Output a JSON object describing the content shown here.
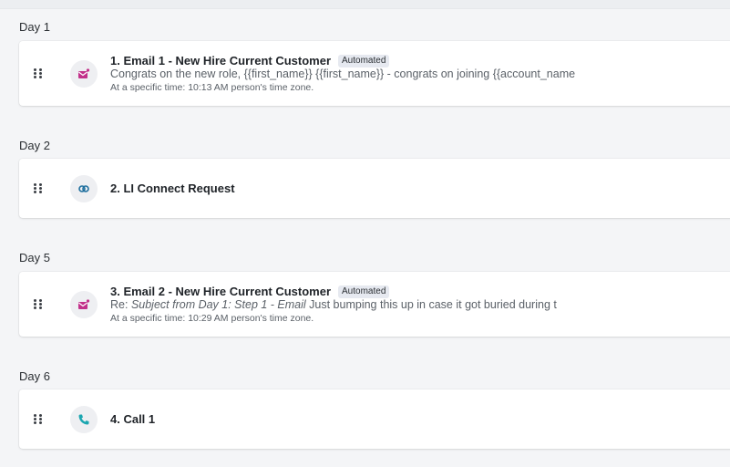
{
  "colors": {
    "background": "#f4f5f7",
    "card": "#ffffff",
    "email_icon": "#c2308a",
    "linkedin_icon": "#1f6f9e",
    "call_icon": "#1ba6b0"
  },
  "steps": [
    {
      "day_label": "Day 1",
      "icon": "email-icon",
      "title": "1. Email 1 - New Hire Current Customer",
      "badge": "Automated",
      "preview": "Congrats on the new role, {{first_name}} {{first_name}} - congrats on joining {{account_name",
      "timing": "At a specific time: 10:13 AM person's time zone."
    },
    {
      "day_label": "Day 2",
      "icon": "linkedin-connect-icon",
      "title": "2. LI Connect Request"
    },
    {
      "day_label": "Day 5",
      "icon": "email-icon",
      "title": "3. Email 2 - New Hire Current Customer",
      "badge": "Automated",
      "preview_prefix": "Re: ",
      "preview_italic": "Subject from Day 1: Step 1 - Email",
      "preview_rest": " Just bumping this up in case it got buried during t",
      "timing": "At a specific time: 10:29 AM person's time zone."
    },
    {
      "day_label": "Day 6",
      "icon": "phone-icon",
      "title": "4. Call 1"
    }
  ]
}
